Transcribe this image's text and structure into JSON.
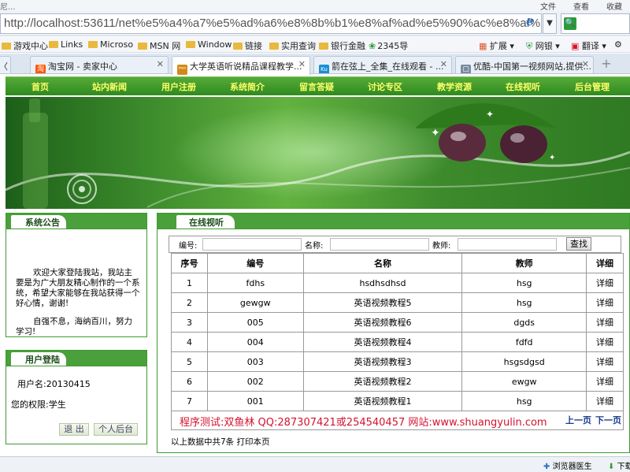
{
  "browser": {
    "menu_left": "尼...",
    "menu_right": [
      "文件",
      "查看",
      "收藏"
    ],
    "url_host": "http://localhost",
    "url_rest": ":53611/net%e5%a4%a7%e5%ad%a6%e8%8b%b1%e8%af%ad%e5%90%ac%e8%af%b4%e7%b2",
    "favorites": [
      "游戏中心",
      "Links",
      "Microso",
      "MSN 网",
      "Window",
      "链接",
      "实用查询",
      "银行金融",
      "2345导"
    ],
    "extensions": [
      "扩展",
      "网银",
      "翻译"
    ],
    "tabs": [
      {
        "title": "淘宝网 - 卖家中心",
        "icon": "淘",
        "color": "#ff5500"
      },
      {
        "title": "大学英语听说精品课程教学...",
        "icon": "ᴾᴹᴬ",
        "color": "#d38a1a"
      },
      {
        "title": "箭在弦上_全集_在线观看 - ...",
        "icon": "Ku",
        "color": "#1b8fd6"
      },
      {
        "title": "优酷-中国第一视频网站,提供...",
        "icon": "▢",
        "color": "#7a8aa0"
      }
    ],
    "status_items": [
      "浏览器医生",
      "下载"
    ]
  },
  "site": {
    "nav": [
      "首页",
      "站内新闻",
      "用户注册",
      "系统简介",
      "留言答疑",
      "讨论专区",
      "教学资源",
      "在线视听",
      "后台管理"
    ],
    "notice": {
      "title": "系统公告",
      "p1": "欢迎大家登陆我站，我站主要是为广大朋友精心制作的一个系统，希望大家能够在我站获得一个好心情，谢谢!",
      "p2": "自强不息，海纳百川，努力学习!"
    },
    "login": {
      "title": "用户登陆",
      "username": "用户名:20130415",
      "permission": "您的权限:学生",
      "logout": "退 出",
      "personal": "个人后台"
    },
    "main": {
      "title": "在线视听",
      "search": {
        "code_label": "编号:",
        "name_label": "名称:",
        "teacher_label": "教师:",
        "button": "查找"
      },
      "columns": [
        "序号",
        "编号",
        "名称",
        "教师",
        "详细"
      ],
      "rows": [
        [
          "1",
          "fdhs",
          "hsdhsdhsd",
          "hsg",
          "详细"
        ],
        [
          "2",
          "gewgw",
          "英语视频教程5",
          "hsg",
          "详细"
        ],
        [
          "3",
          "005",
          "英语视频教程6",
          "dgds",
          "详细"
        ],
        [
          "4",
          "004",
          "英语视频教程4",
          "fdfd",
          "详细"
        ],
        [
          "5",
          "003",
          "英语视频教程3",
          "hsgsdgsd",
          "详细"
        ],
        [
          "6",
          "002",
          "英语视频教程2",
          "ewgw",
          "详细"
        ],
        [
          "7",
          "001",
          "英语视频教程1",
          "hsg",
          "详细"
        ]
      ],
      "test_text": "程序测试:双鱼林 QQ:287307421或254540457 网站:www.shuangyulin.com",
      "prev": "上一页",
      "next": "下一页",
      "summary": "以上数据中共7条   打印本页"
    }
  }
}
